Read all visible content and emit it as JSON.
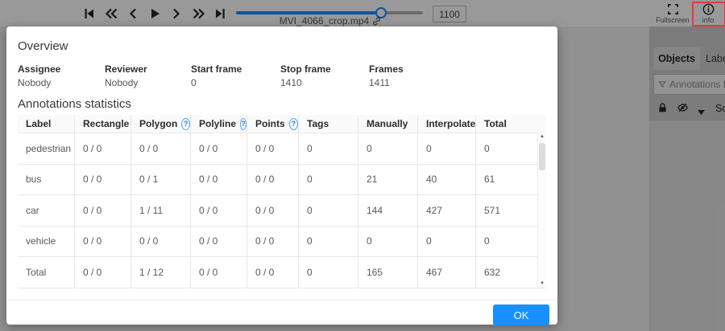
{
  "player": {
    "buttons": [
      "first-frame-icon",
      "backward-jump-icon",
      "previous-frame-icon",
      "play-icon",
      "next-frame-icon",
      "forward-jump-icon",
      "last-frame-icon"
    ],
    "filename": "MVI_4066_crop.mp4",
    "frame_value": "1100",
    "slider_value_fraction": 0.78
  },
  "topbar_right": {
    "fullscreen_label": "Fullscreen",
    "info_label": "info"
  },
  "sidebar": {
    "tabs": [
      {
        "label": "Objects",
        "active": true
      },
      {
        "label": "Labels",
        "active": false
      }
    ],
    "filter_placeholder": "Annotations filter",
    "icons": [
      "lock-icon",
      "eye-invisible-icon",
      "caret-down-icon"
    ],
    "sort_label": "Sort"
  },
  "modal": {
    "overview": {
      "title": "Overview",
      "fields": [
        {
          "label": "Assignee",
          "value": "Nobody"
        },
        {
          "label": "Reviewer",
          "value": "Nobody"
        },
        {
          "label": "Start frame",
          "value": "0"
        },
        {
          "label": "Stop frame",
          "value": "1410"
        },
        {
          "label": "Frames",
          "value": "1411"
        }
      ]
    },
    "statistics": {
      "title": "Annotations statistics",
      "columns": [
        {
          "label": "Label",
          "help": false
        },
        {
          "label": "Rectangle",
          "help": true
        },
        {
          "label": "Polygon",
          "help": true
        },
        {
          "label": "Polyline",
          "help": true
        },
        {
          "label": "Points",
          "help": true
        },
        {
          "label": "Tags",
          "help": false
        },
        {
          "label": "Manually",
          "help": false
        },
        {
          "label": "Interpolated",
          "help": false
        },
        {
          "label": "Total",
          "help": false
        }
      ],
      "rows": [
        {
          "cells": [
            "pedestrian",
            "0 / 0",
            "0 / 0",
            "0 / 0",
            "0 / 0",
            "0",
            "0",
            "0",
            "0"
          ]
        },
        {
          "cells": [
            "bus",
            "0 / 0",
            "0 / 1",
            "0 / 0",
            "0 / 0",
            "0",
            "21",
            "40",
            "61"
          ]
        },
        {
          "cells": [
            "car",
            "0 / 0",
            "1 / 11",
            "0 / 0",
            "0 / 0",
            "0",
            "144",
            "427",
            "571"
          ]
        },
        {
          "cells": [
            "vehicle",
            "0 / 0",
            "0 / 0",
            "0 / 0",
            "0 / 0",
            "0",
            "0",
            "0",
            "0"
          ]
        },
        {
          "cells": [
            "Total",
            "0 / 0",
            "1 / 12",
            "0 / 0",
            "0 / 0",
            "0",
            "165",
            "467",
            "632"
          ]
        }
      ]
    },
    "ok_label": "OK"
  },
  "colors": {
    "accent_blue": "#1890ff",
    "highlight_red": "#e13c3c"
  }
}
